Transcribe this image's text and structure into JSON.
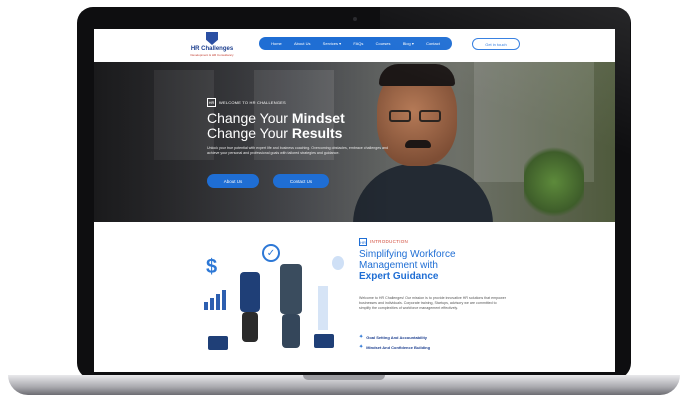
{
  "nav": {
    "logo_name": "HR Challenges",
    "logo_tagline": "Development & HR Consultancy",
    "items": [
      "Home",
      "About Us",
      "Services ▾",
      "FAQs",
      "Courses",
      "Blog ▾",
      "Contact"
    ],
    "cta": "Get in touch"
  },
  "hero": {
    "welcome": "WELCOME TO HR CHALLENGES",
    "line1_prefix": "Change Your ",
    "line1_bold": "Mindset",
    "line2_prefix": "Change Your ",
    "line2_bold": "Results",
    "lead": "Unlock your true potential with expert life and business coaching. Overcoming obstacles, embrace challenges and achieve your personal and professional goals with tailored strategies and guidance.",
    "btn_about": "About Us",
    "btn_contact": "Contact Us"
  },
  "intro": {
    "label": "INTRODUCTION",
    "title_line1": "Simplifying Workforce",
    "title_line2": "Management with",
    "title_bold": "Expert Guidance",
    "paragraph": "Welcome to HR Challenges! Our mission is to provide innovative HR solutions that empower businesses and individuals. Corporate training, Startups, advisory we are committed to simplify the complexities of workforce management effectively.",
    "list": [
      "Goal Setting And Accountability",
      "Mindset And Confidence Building"
    ]
  },
  "colors": {
    "brand_blue": "#1f6ed4",
    "accent_red": "#d14a3a",
    "bezel": "#0e0e10"
  }
}
